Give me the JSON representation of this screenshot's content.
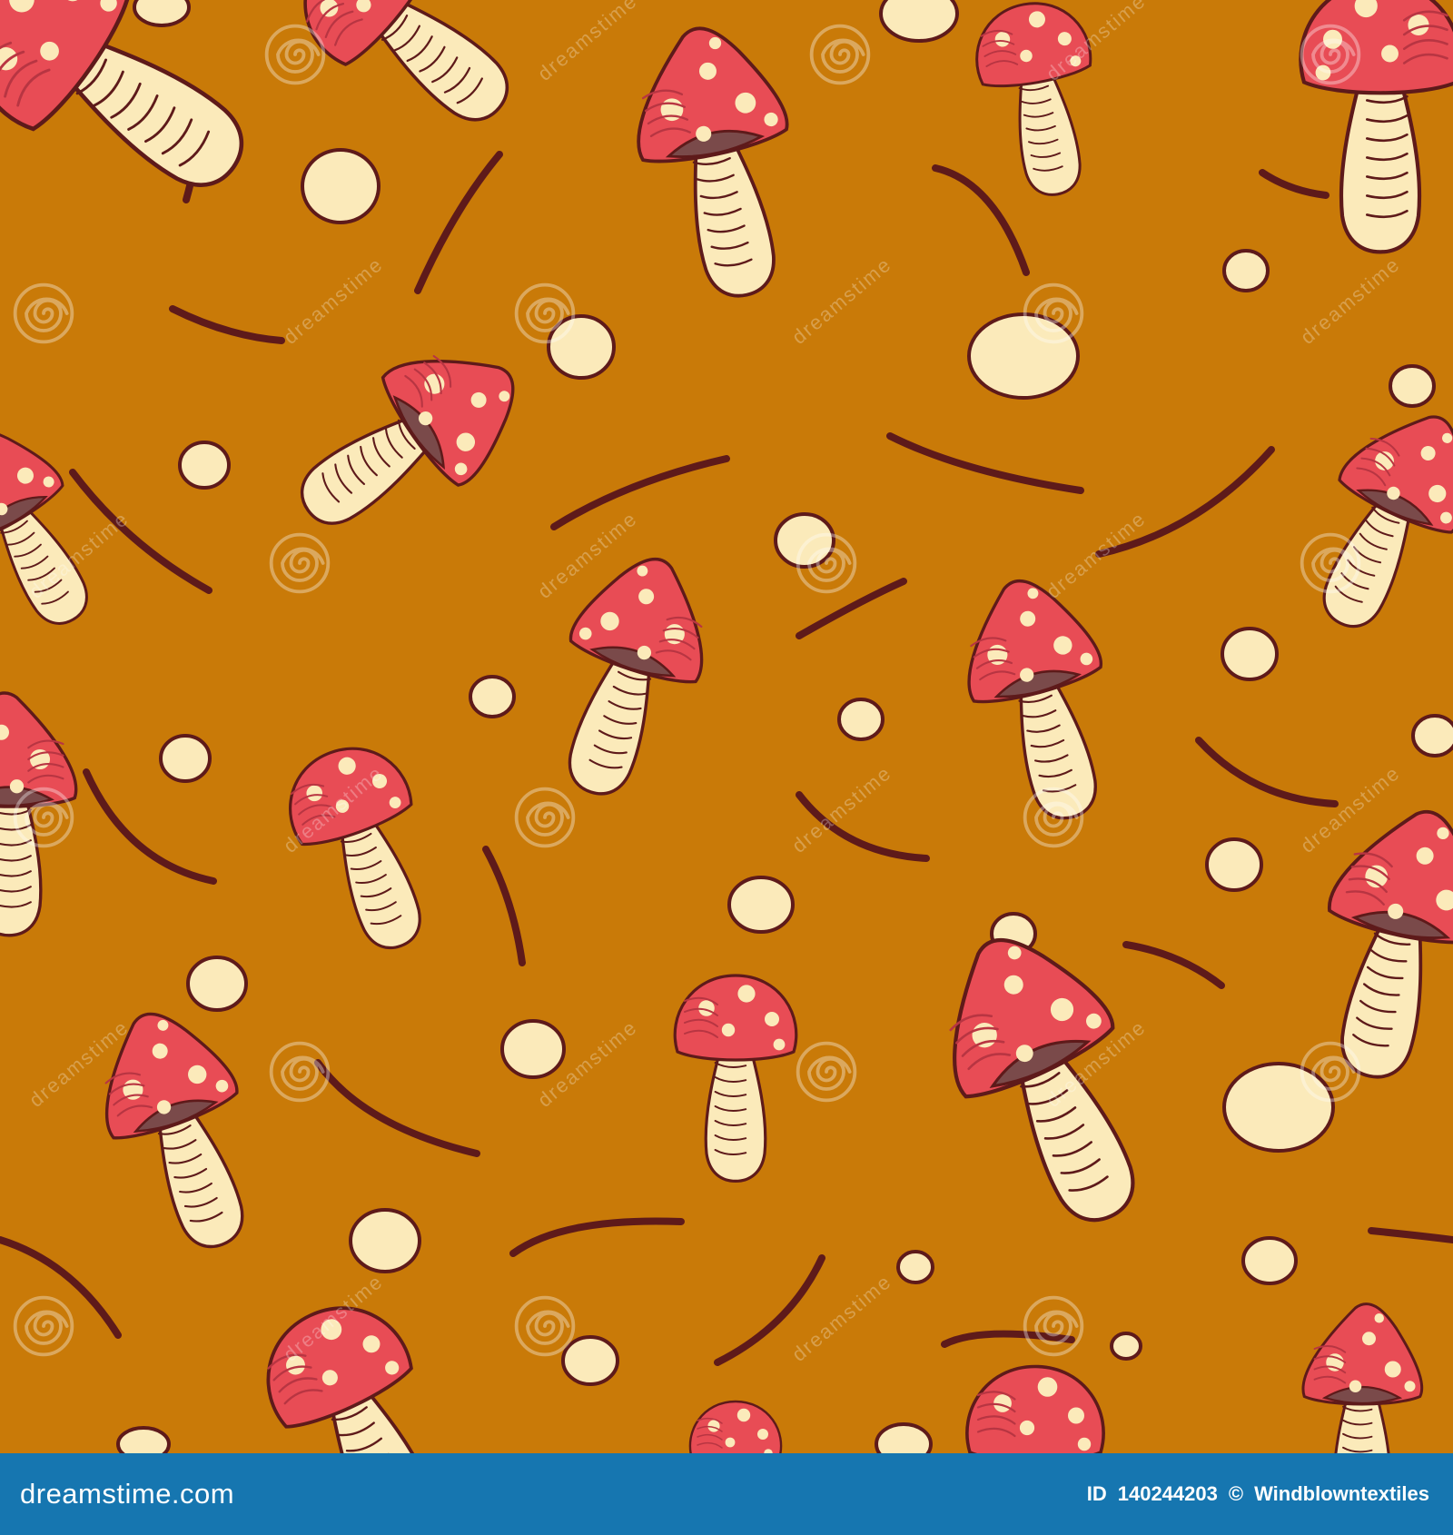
{
  "colors": {
    "background": "#C97A08",
    "cap": "#E84C55",
    "cap_dark": "#B83542",
    "gills": "#7A4A4A",
    "cream": "#FBEABA",
    "outline": "#5E1A1A",
    "footer": "#1676B0",
    "watermark": "#FFFFFF"
  },
  "icons": {
    "watermark": "spiral-icon"
  },
  "watermark": {
    "text": "dreamstime"
  },
  "footer": {
    "site": "dreamstime.com",
    "id_label": "ID",
    "id_value": "140244203",
    "copyright_symbol": "©",
    "author": "Windblowntextiles"
  }
}
